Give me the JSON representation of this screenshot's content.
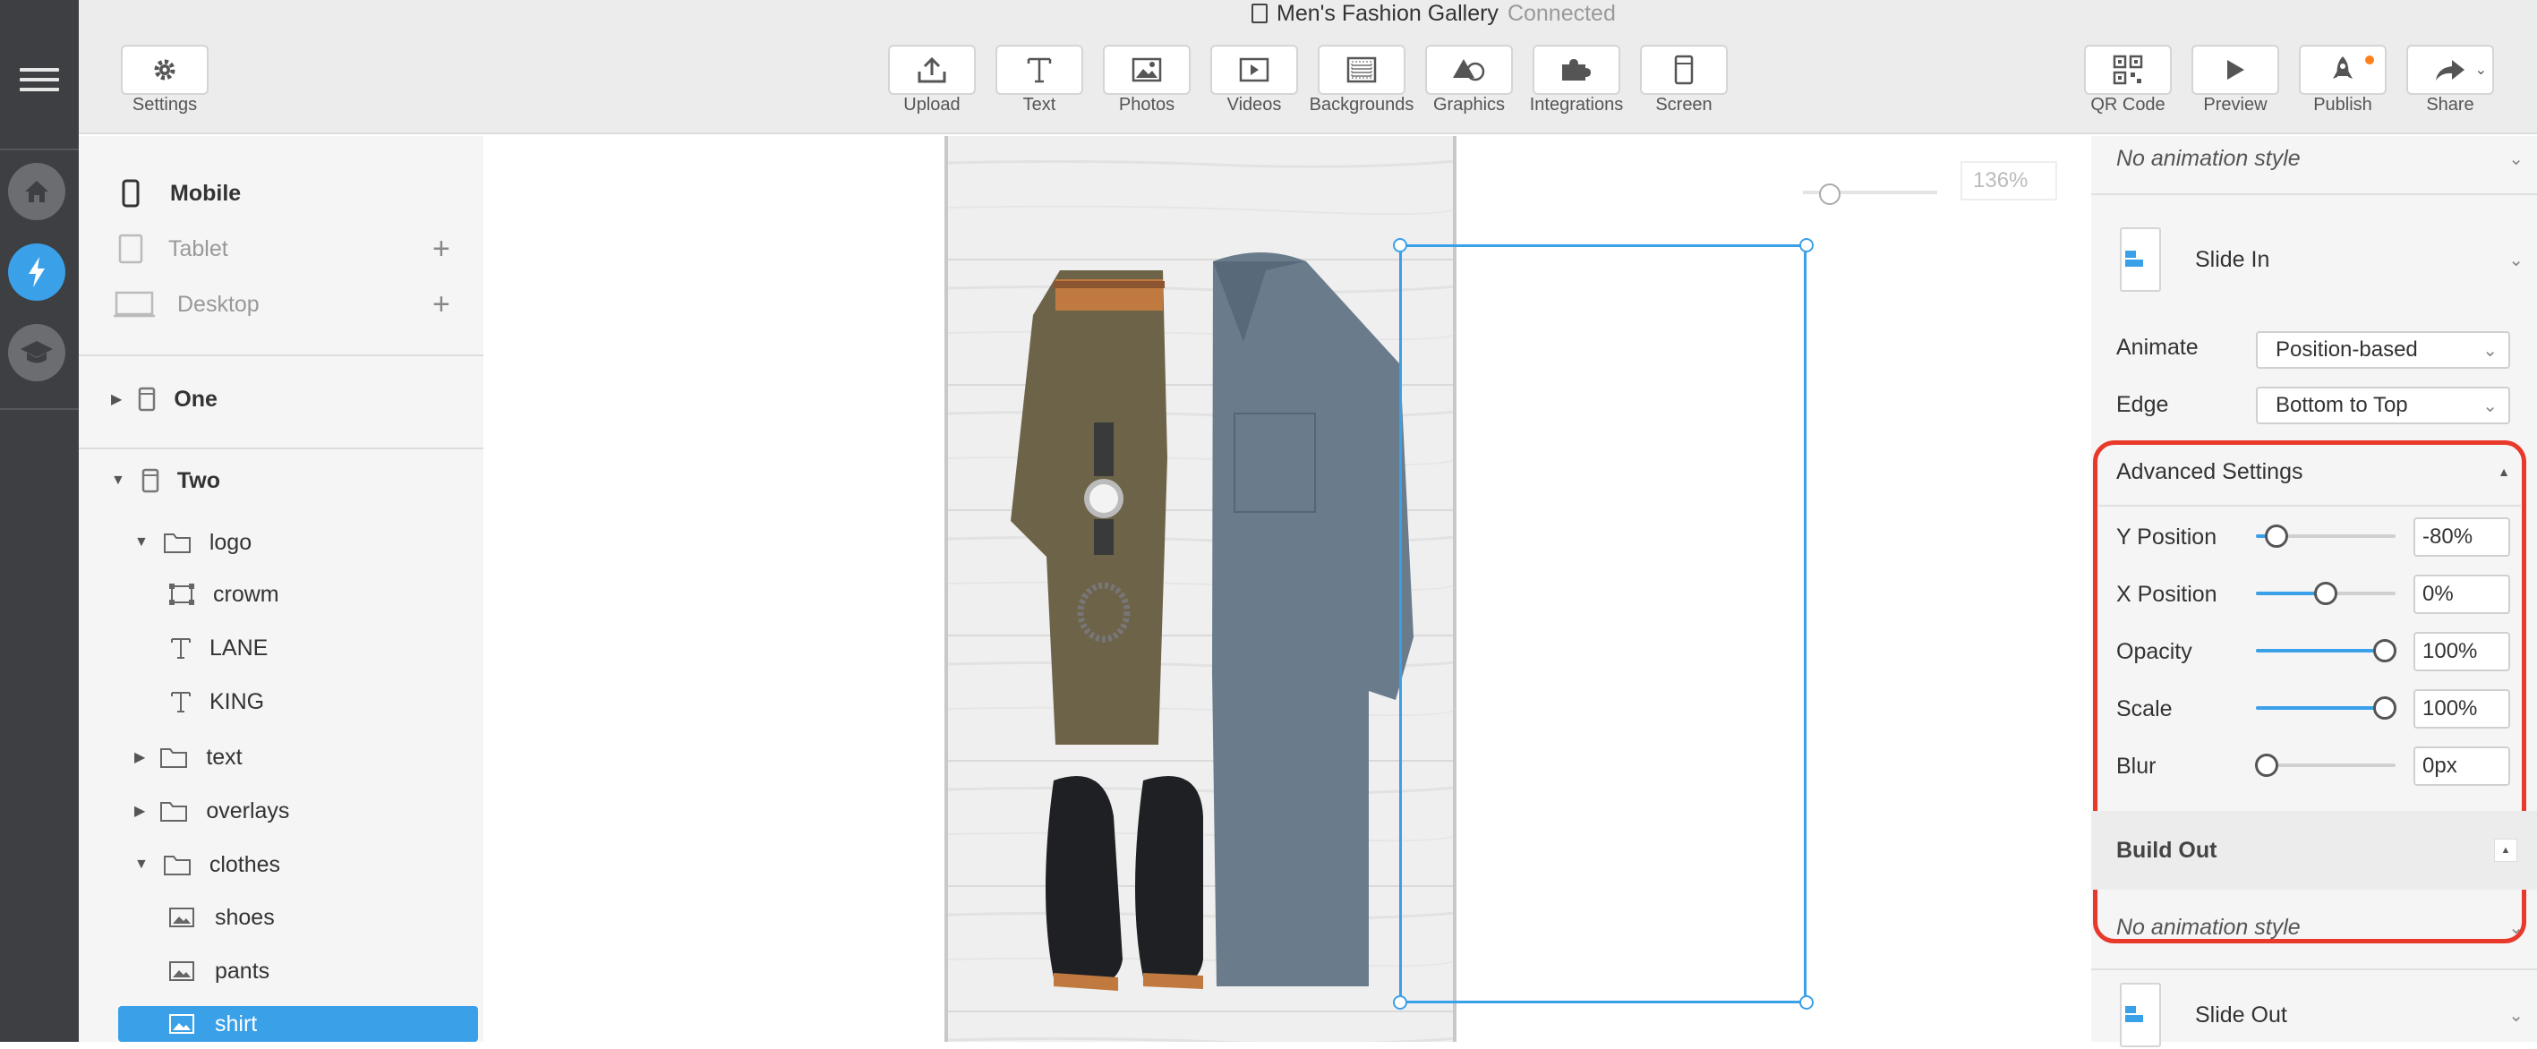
{
  "window": {
    "title": "Men's Fashion Gallery",
    "status": "Connected"
  },
  "toolbar": {
    "settings": "Settings",
    "center": [
      "Upload",
      "Text",
      "Photos",
      "Videos",
      "Backgrounds",
      "Graphics",
      "Integrations",
      "Screen"
    ],
    "right": [
      "QR Code",
      "Preview",
      "Publish",
      "Share"
    ]
  },
  "devices": {
    "mobile": "Mobile",
    "tablet": "Tablet",
    "desktop": "Desktop"
  },
  "layers": {
    "screen_one": "One",
    "screen_two": "Two",
    "logo": "logo",
    "crowm": "crowm",
    "lane": "LANE",
    "king": "KING",
    "text": "text",
    "overlays": "overlays",
    "clothes": "clothes",
    "shoes": "shoes",
    "pants": "pants",
    "shirt": "shirt"
  },
  "canvas": {
    "zoom": "136%",
    "zoom_level": 0.2
  },
  "props": {
    "build_in_style": "No animation style",
    "slide_in": "Slide In",
    "animate_label": "Animate",
    "animate_value": "Position-based",
    "edge_label": "Edge",
    "edge_value": "Bottom to Top",
    "advanced": "Advanced Settings",
    "y_label": "Y Position",
    "y_value": "-80%",
    "y_level": 0.15,
    "x_label": "X Position",
    "x_value": "0%",
    "x_level": 0.5,
    "opacity_label": "Opacity",
    "opacity_value": "100%",
    "opacity_level": 0.92,
    "scale_label": "Scale",
    "scale_value": "100%",
    "scale_level": 0.92,
    "blur_label": "Blur",
    "blur_value": "0px",
    "blur_level": 0.08,
    "build_out": "Build Out",
    "build_out_style": "No animation style",
    "slide_out": "Slide Out"
  },
  "colors": {
    "accent": "#3aa0e8",
    "highlight": "#e8392b",
    "rail": "#3d3f42"
  }
}
